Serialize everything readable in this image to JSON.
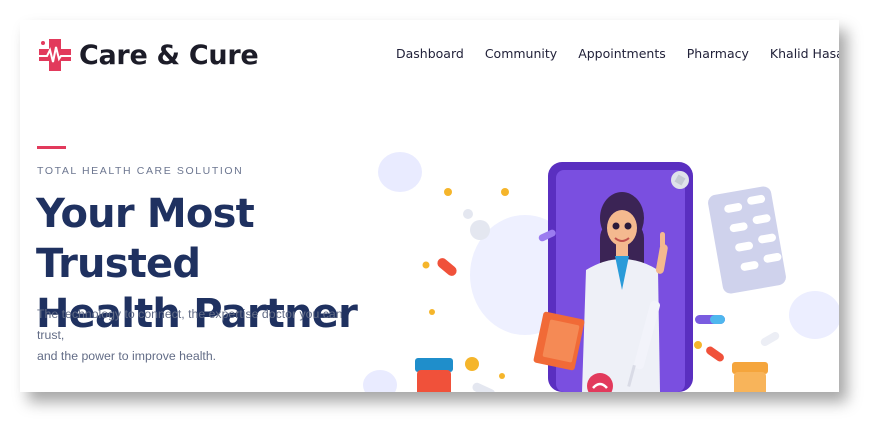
{
  "brand": {
    "name": "Care & Cure",
    "accent": "#e23a5c",
    "primary": "#1f3160"
  },
  "nav": {
    "items": [
      {
        "label": "Dashboard"
      },
      {
        "label": "Community"
      },
      {
        "label": "Appointments"
      },
      {
        "label": "Pharmacy"
      }
    ],
    "user": {
      "label": "Khalid Hasan",
      "icon": "chevron-down-icon"
    }
  },
  "hero": {
    "eyebrow": "TOTAL HEALTH CARE SOLUTION",
    "headline_line1": "Your Most Trusted",
    "headline_line2": "Health Partner",
    "subtext_line1": "The technology to connect, the expertise doctor you can trust,",
    "subtext_line2": "and the power to improve health."
  }
}
